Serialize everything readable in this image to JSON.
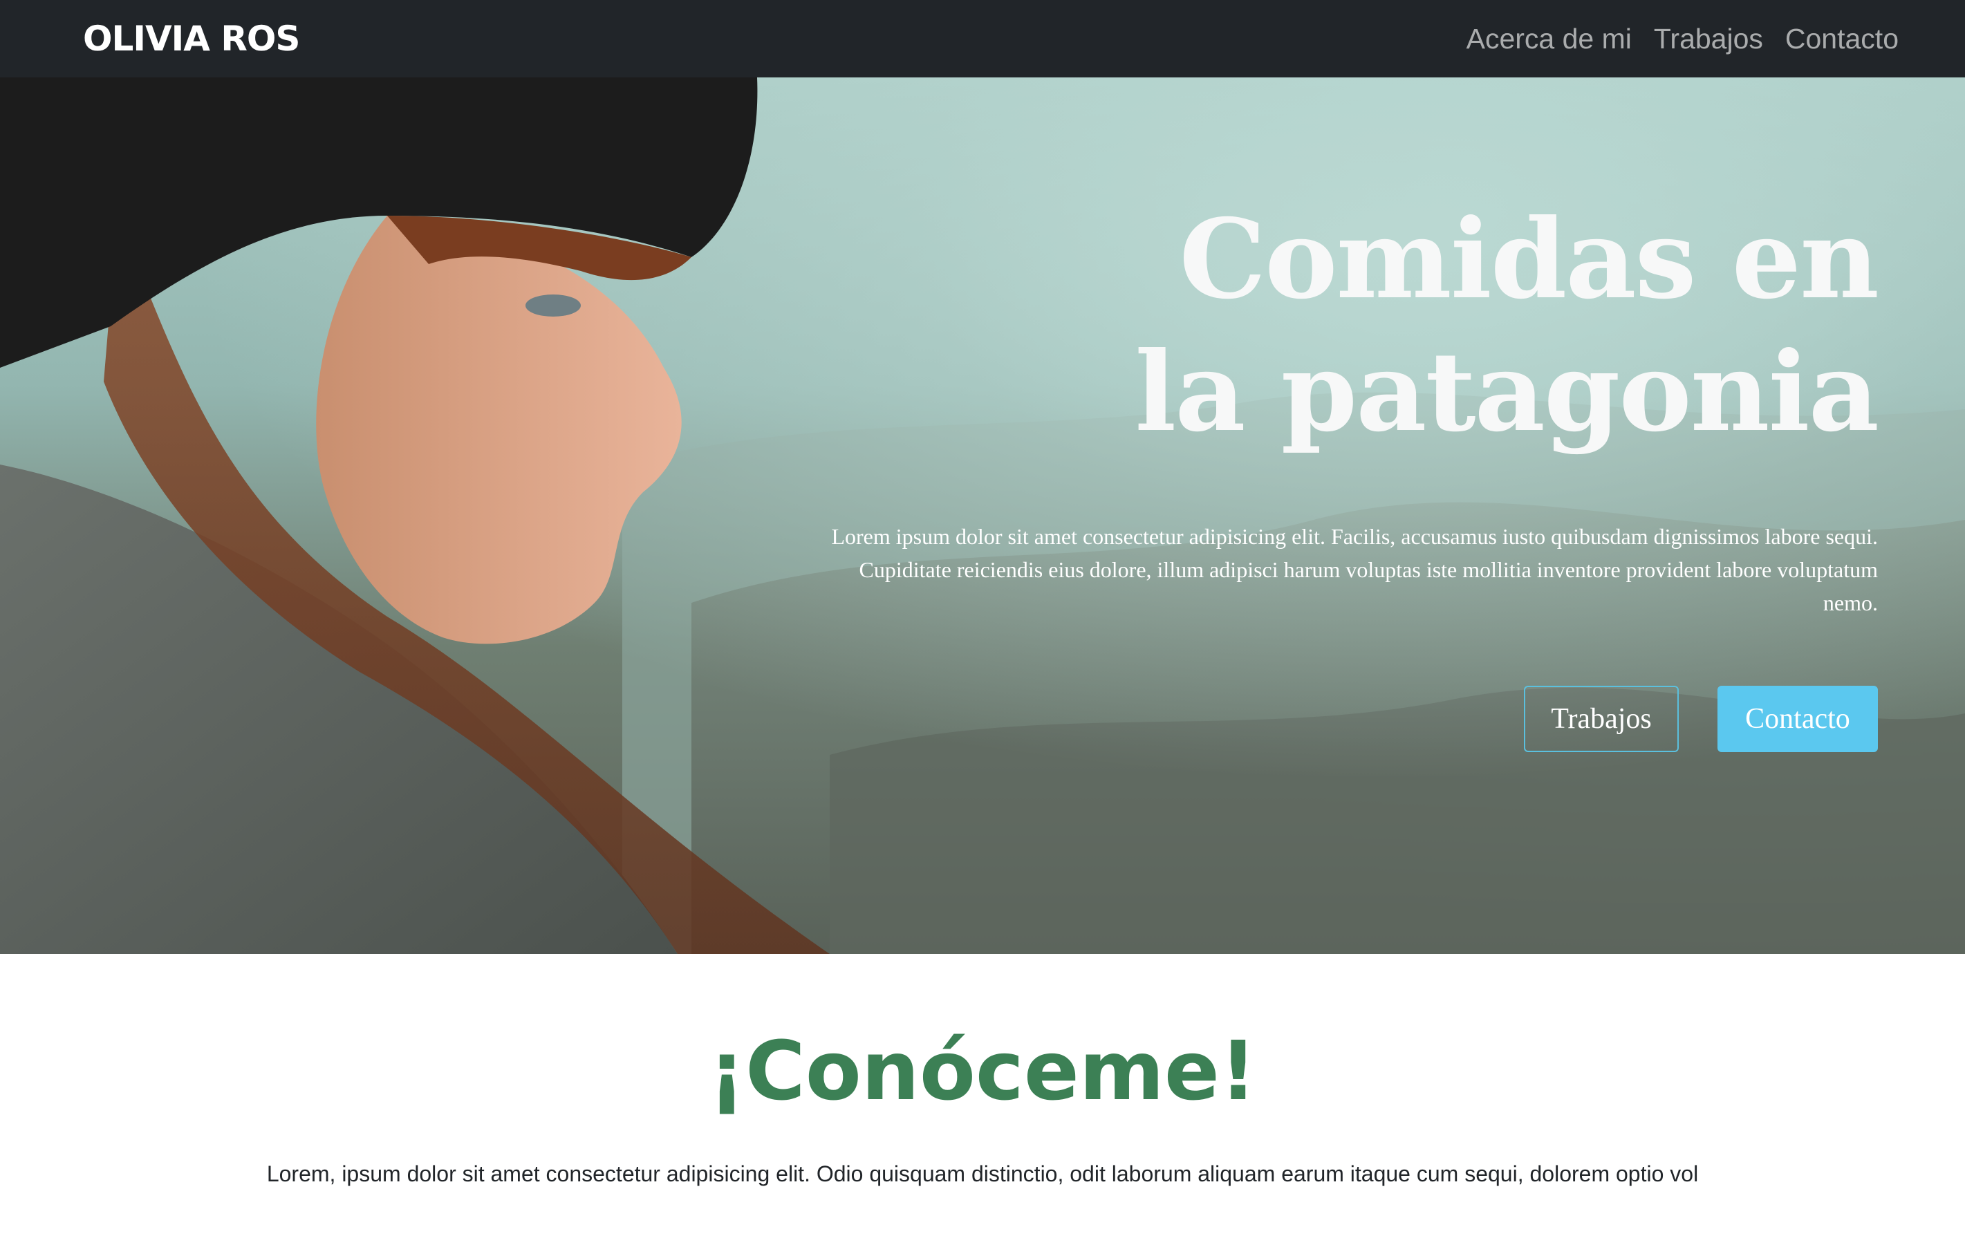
{
  "navbar": {
    "brand": "OLIVIA ROS",
    "links": [
      {
        "label": "Acerca de mi"
      },
      {
        "label": "Trabajos"
      },
      {
        "label": "Contacto"
      }
    ]
  },
  "hero": {
    "title_line1": "Comidas en",
    "title_line2": "la patagonia",
    "paragraph": "Lorem ipsum dolor sit amet consectetur adipisicing elit. Facilis, accusamus iusto quibusdam dignissimos labore sequi. Cupiditate reiciendis eius dolore, illum adipisci harum voluptas iste mollitia inventore provident labore voluptatum nemo.",
    "buttons": {
      "works_label": "Trabajos",
      "contact_label": "Contacto"
    },
    "accent_color": "#5bc8ef"
  },
  "about": {
    "title": "¡Conóceme!",
    "title_color": "#3c8055",
    "text": "Lorem, ipsum dolor sit amet consectetur adipisicing elit. Odio quisquam distinctio, odit laborum aliquam earum itaque cum sequi, dolorem optio vol"
  }
}
